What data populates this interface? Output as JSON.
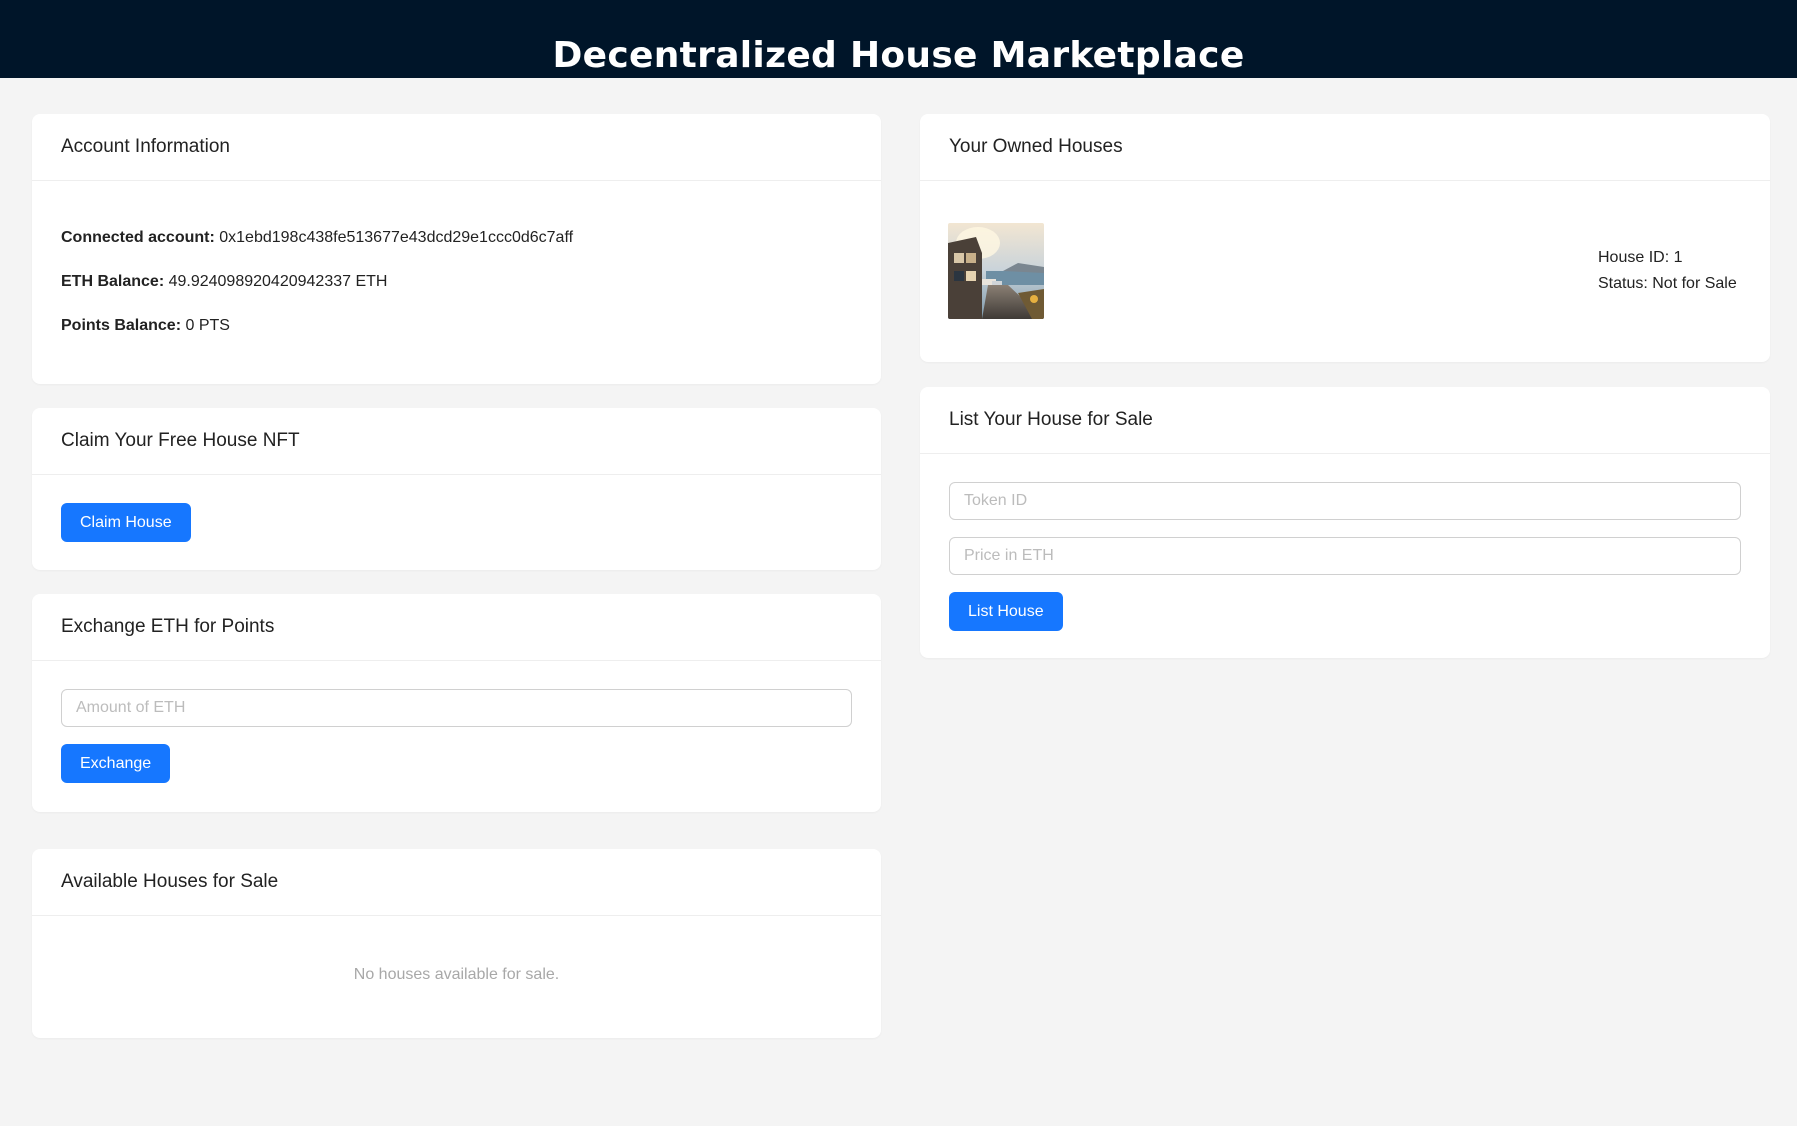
{
  "header": {
    "title": "Decentralized House Marketplace"
  },
  "account": {
    "title": "Account Information",
    "connected_label": "Connected account:",
    "connected_value": "0x1ebd198c438fe513677e43dcd29e1ccc0d6c7aff",
    "eth_label": "ETH Balance:",
    "eth_value": "49.924098920420942337 ETH",
    "points_label": "Points Balance:",
    "points_value": "0 PTS"
  },
  "claim": {
    "title": "Claim Your Free House NFT",
    "button": "Claim House"
  },
  "exchange": {
    "title": "Exchange ETH for Points",
    "placeholder": "Amount of ETH",
    "button": "Exchange"
  },
  "available": {
    "title": "Available Houses for Sale",
    "empty": "No houses available for sale."
  },
  "owned": {
    "title": "Your Owned Houses",
    "houses": [
      {
        "id_text": "House ID: 1",
        "status_text": "Status: Not for Sale"
      }
    ]
  },
  "list": {
    "title": "List Your House for Sale",
    "token_placeholder": "Token ID",
    "price_placeholder": "Price in ETH",
    "button": "List House"
  },
  "colors": {
    "header_bg": "#001529",
    "primary": "#1677ff",
    "page_bg": "#f4f4f4"
  }
}
